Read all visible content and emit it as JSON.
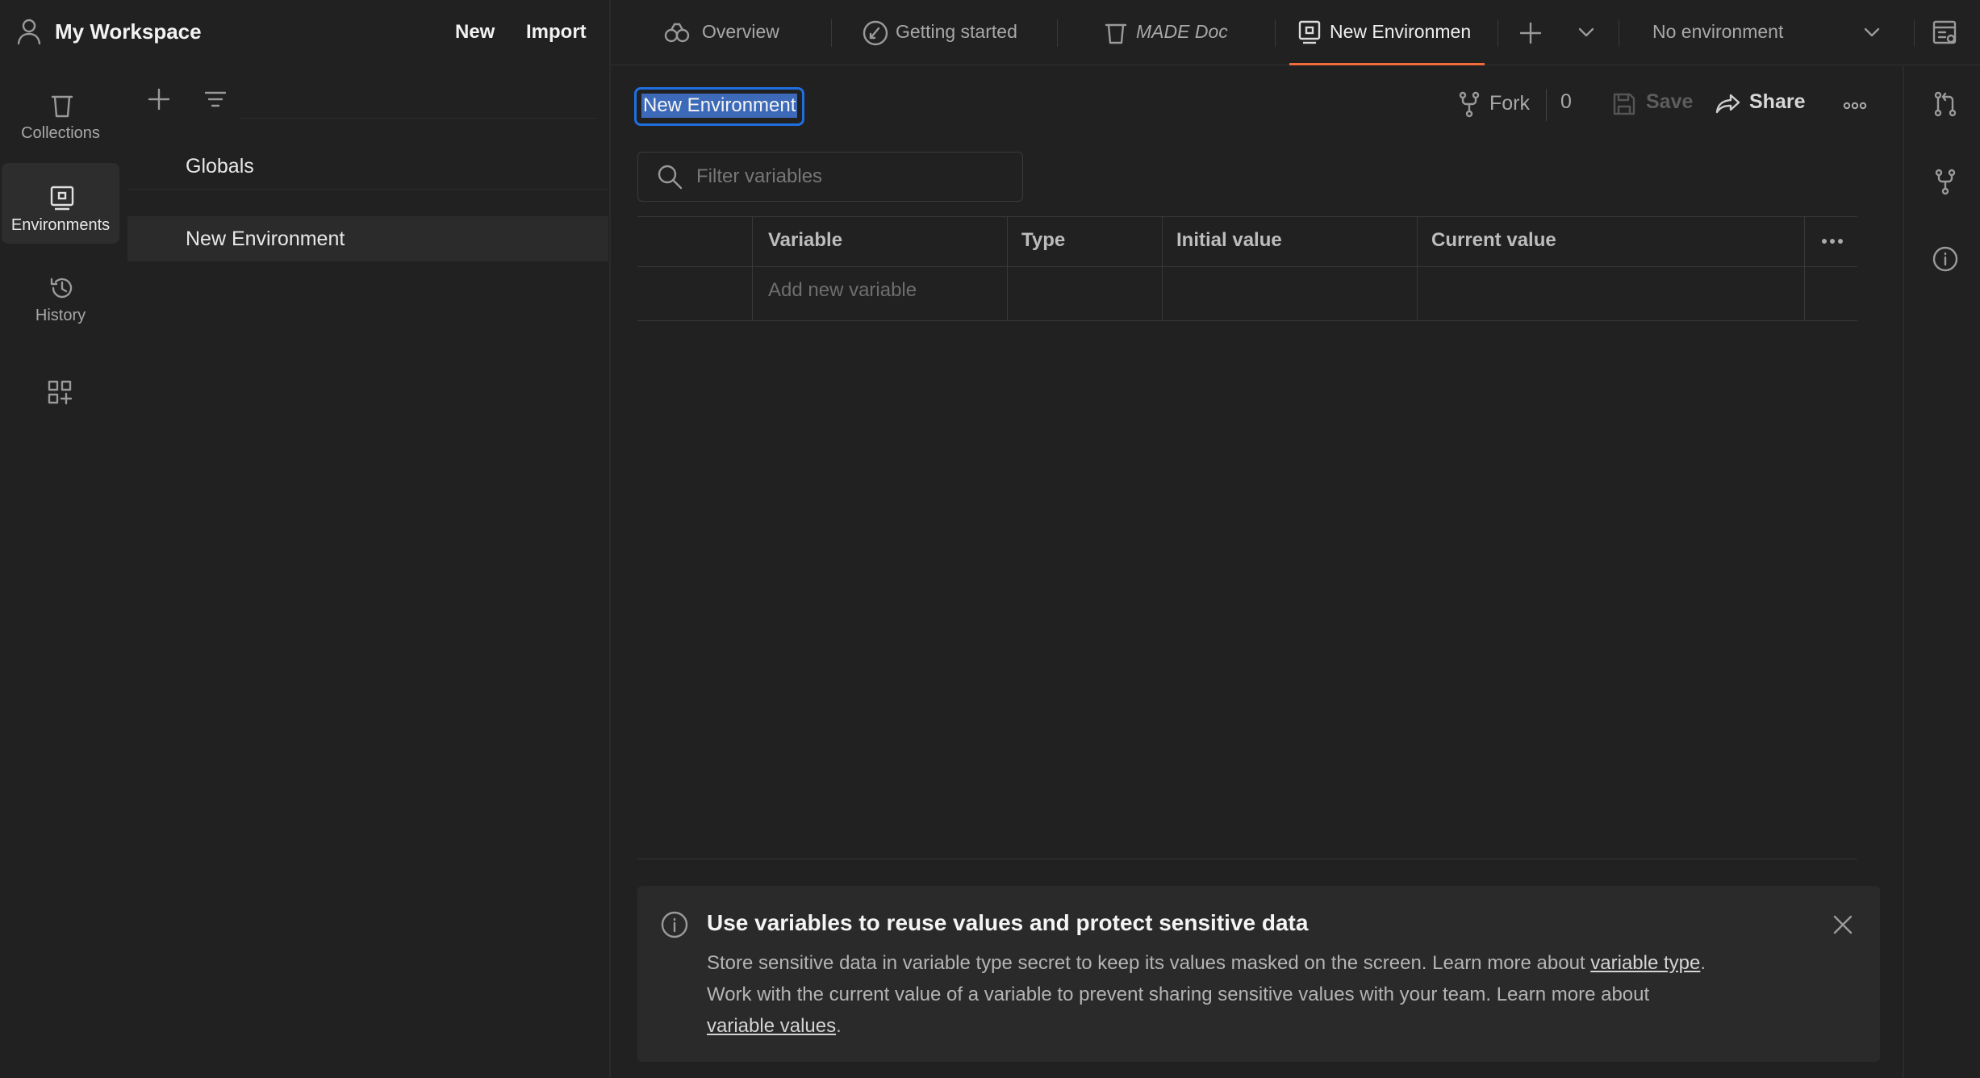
{
  "workspace": {
    "title": "My Workspace",
    "new_label": "New",
    "import_label": "Import"
  },
  "rail": {
    "collections": "Collections",
    "environments": "Environments",
    "history": "History"
  },
  "env_list": {
    "globals": "Globals",
    "active_env": "New Environment"
  },
  "tabs": {
    "overview": "Overview",
    "getting_started": "Getting started",
    "made_doc": "MADE Doc",
    "new_env": "New Environmen"
  },
  "env_selector": "No environment",
  "editor": {
    "env_name": "New Environment",
    "fork_label": "Fork",
    "fork_count": "0",
    "save_label": "Save",
    "share_label": "Share",
    "filter_placeholder": "Filter variables"
  },
  "table": {
    "columns": [
      "Variable",
      "Type",
      "Initial value",
      "Current value"
    ],
    "add_placeholder": "Add new variable"
  },
  "banner": {
    "title": "Use variables to reuse values and protect sensitive data",
    "line1": "Store sensitive data in variable type secret to keep its values masked on the screen. Learn more about ",
    "link1": "variable type",
    "line2": "Work with the current value of a variable to prevent sharing sensitive values with your team. Learn more about",
    "link2": "variable values"
  },
  "colors": {
    "accent_tab": "#f26b3a",
    "selection": "#1f6fe0",
    "background": "#212121"
  }
}
